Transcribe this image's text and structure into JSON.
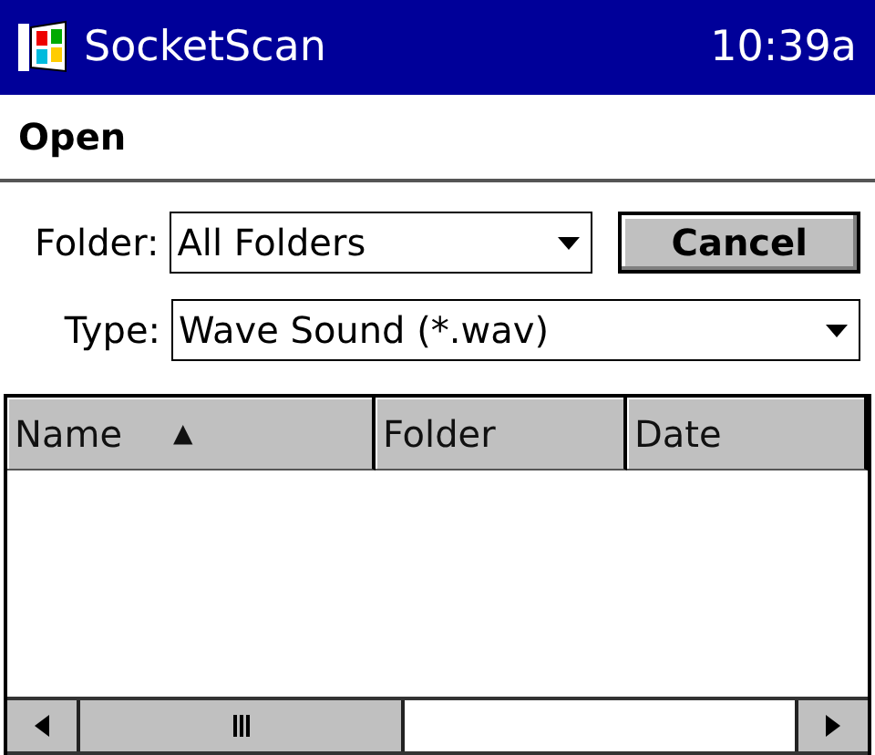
{
  "title_bar": {
    "title": "SocketScan",
    "time": "10:39a"
  },
  "header": {
    "title": "Open"
  },
  "folder": {
    "label": "Folder:",
    "value": "All Folders"
  },
  "cancel_button": {
    "label": "Cancel"
  },
  "type": {
    "label": "Type:",
    "value": "Wave Sound (*.wav)"
  },
  "table": {
    "columns": [
      {
        "label": "Name",
        "sort_mark": "▲"
      },
      {
        "label": "Folder"
      },
      {
        "label": "Date"
      }
    ]
  }
}
